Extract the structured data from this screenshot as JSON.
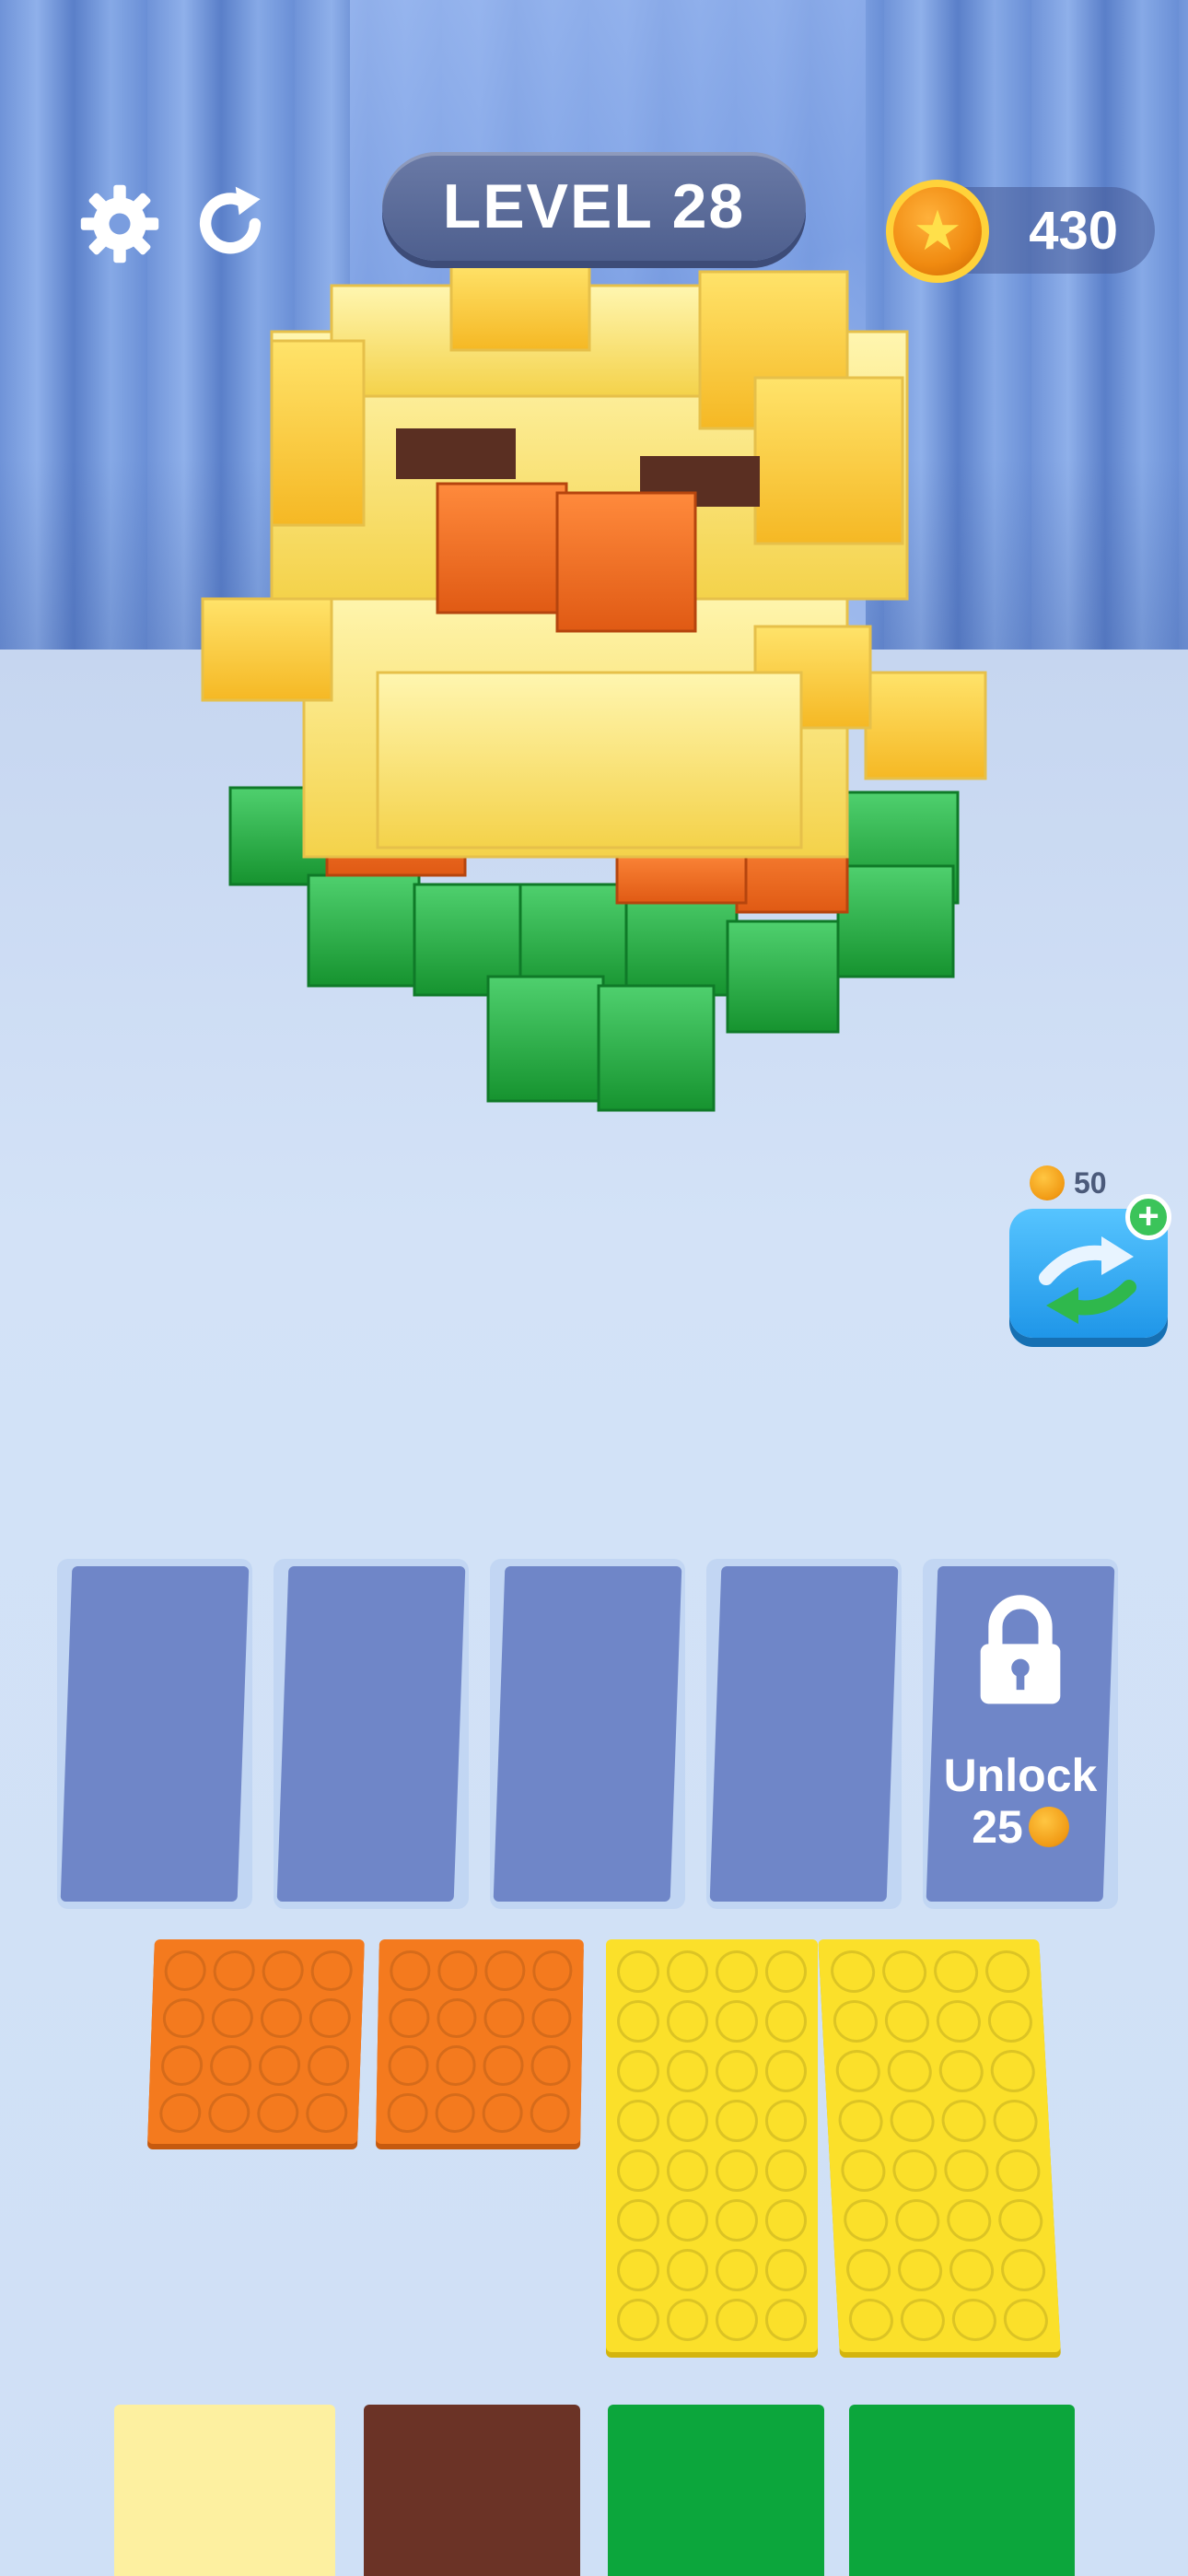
{
  "hud": {
    "level_label": "LEVEL 28",
    "coin_count": "430",
    "settings_icon": "gear-icon",
    "restart_icon": "restart-icon",
    "coin_icon": "star-coin-icon"
  },
  "booster": {
    "cost": "50",
    "icon": "shuffle-arrows-icon",
    "plus_icon": "plus-icon"
  },
  "slots": {
    "count_open": 4,
    "locked_slot": {
      "label": "Unlock",
      "cost": "25",
      "icon": "lock-icon"
    }
  },
  "plates": [
    {
      "color": "#f47a1e",
      "cols": 4,
      "rows": 4
    },
    {
      "color": "#f47a1e",
      "cols": 4,
      "rows": 4
    },
    {
      "color": "#fbe02a",
      "cols": 4,
      "rows": 8
    },
    {
      "color": "#fbe02a",
      "cols": 4,
      "rows": 8
    }
  ],
  "bottom_row_colors": [
    "#fdf0a0",
    "#6b3326",
    "#0ca63c",
    "#0ca63c"
  ],
  "colors": {
    "slot_fill": "#6f86c8",
    "level_pill": "#55648f",
    "curtain": "#7a9ddf",
    "floor": "#cfe0f6"
  }
}
